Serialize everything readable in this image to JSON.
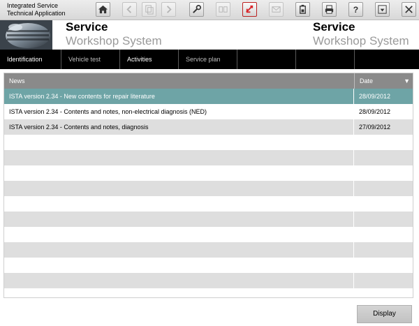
{
  "app": {
    "title_line1": "Integrated Service",
    "title_line2": "Technical Application"
  },
  "brand": {
    "line1": "Service",
    "line2": "Workshop System"
  },
  "toolbar_icons": [
    "home-icon",
    "back-icon",
    "copy-icon",
    "forward-icon",
    "wrench-icon",
    "connection-icon",
    "swap-icon",
    "mail-icon",
    "battery-icon",
    "print-icon",
    "help-icon",
    "minimize-icon",
    "close-icon"
  ],
  "nav": {
    "tabs": [
      {
        "label": "Identification"
      },
      {
        "label": "Vehicle test"
      },
      {
        "label": "Activities"
      },
      {
        "label": "Service plan"
      },
      {
        "label": ""
      },
      {
        "label": ""
      },
      {
        "label": ""
      }
    ]
  },
  "table": {
    "headers": {
      "news": "News",
      "date": "Date"
    },
    "rows": [
      {
        "news": "ISTA version 2.34 - New contents for repair literature",
        "date": "28/09/2012",
        "selected": true
      },
      {
        "news": "ISTA version 2.34 - Contents and notes, non-electrical diagnosis (NED)",
        "date": "28/09/2012"
      },
      {
        "news": "ISTA version 2.34 - Contents and notes, diagnosis",
        "date": "27/09/2012"
      }
    ]
  },
  "actions": {
    "display_label": "Display"
  },
  "colors": {
    "selected_row": "#6ea4a6",
    "accent_red": "#d9252a",
    "nav_bg": "#000000",
    "header_row": "#8a8a8a"
  }
}
